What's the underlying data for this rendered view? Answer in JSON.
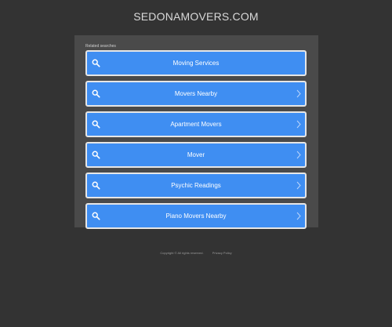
{
  "site": {
    "title": "SEDONAMOVERS.COM"
  },
  "related": {
    "heading": "Related searches",
    "items": [
      {
        "label": "Moving Services",
        "chevron": false
      },
      {
        "label": "Movers Nearby",
        "chevron": true
      },
      {
        "label": "Apartment Movers",
        "chevron": true
      },
      {
        "label": "Mover",
        "chevron": true
      },
      {
        "label": "Psychic Readings",
        "chevron": true
      },
      {
        "label": "Piano Movers Nearby",
        "chevron": true
      }
    ]
  },
  "footer": {
    "copyright": "Copyright © All rights reserved.",
    "privacy": "Privacy Policy"
  },
  "colors": {
    "background": "#333333",
    "panel": "#4a4a4a",
    "button": "#3f8ef2",
    "button_border": "#e6e6e6",
    "title": "#d9d9d9"
  },
  "icons": {
    "search": "search-icon",
    "chevron": "chevron-right-icon"
  }
}
